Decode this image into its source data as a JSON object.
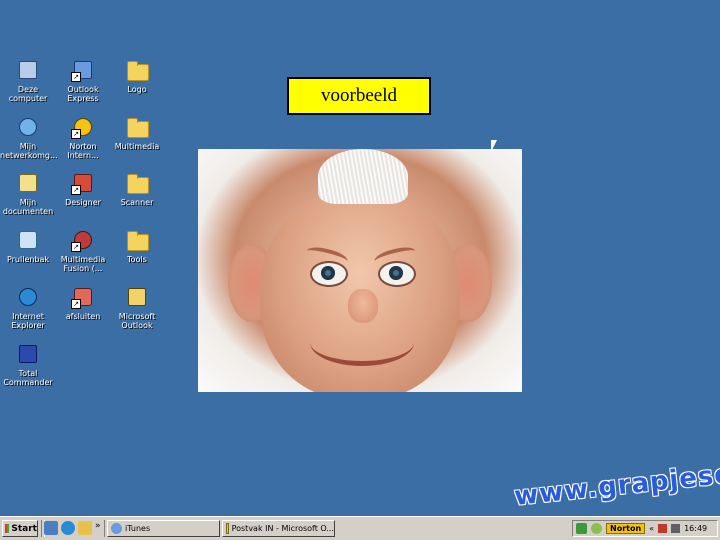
{
  "desktop": {
    "icons": [
      {
        "label": "Deze\ncomputer",
        "icon": "computer-icon"
      },
      {
        "label": "Outlook\nExpress",
        "icon": "outlook-express-icon"
      },
      {
        "label": "Logo",
        "icon": "folder-icon"
      },
      {
        "label": "Mijn\nnetwerkomg...",
        "icon": "network-icon"
      },
      {
        "label": "Norton\nIntern...",
        "icon": "norton-icon"
      },
      {
        "label": "Multimedia",
        "icon": "folder-icon"
      },
      {
        "label": "Mijn\ndocumenten",
        "icon": "my-documents-icon"
      },
      {
        "label": "Designer",
        "icon": "designer-icon"
      },
      {
        "label": "Scanner",
        "icon": "folder-icon"
      },
      {
        "label": "Prullenbak",
        "icon": "recycle-bin-icon"
      },
      {
        "label": "Multimedia\nFusion (...",
        "icon": "multimedia-fusion-icon"
      },
      {
        "label": "Tools",
        "icon": "folder-icon"
      },
      {
        "label": "Internet\nExplorer",
        "icon": "internet-explorer-icon"
      },
      {
        "label": "afsluiten",
        "icon": "shutdown-icon"
      },
      {
        "label": "Microsoft\nOutlook",
        "icon": "microsoft-outlook-icon"
      },
      {
        "label": "Total\nCommander",
        "icon": "total-commander-icon"
      }
    ]
  },
  "callout": {
    "text": "voorbeeld"
  },
  "watermark": {
    "text": "www.grapjesco.nl"
  },
  "taskbar": {
    "start_label": "Start",
    "quick_launch_more": "»",
    "tasks": [
      {
        "label": "iTunes",
        "icon": "itunes-icon"
      },
      {
        "label": "Postvak IN - Microsoft O...",
        "icon": "outlook-icon"
      }
    ],
    "tray": {
      "norton_label": "Norton",
      "more": "«",
      "clock": "16:49"
    }
  },
  "colors": {
    "desktop": "#3b6ea5",
    "callout": "#ffff00",
    "taskbar": "#d4d0c8"
  }
}
